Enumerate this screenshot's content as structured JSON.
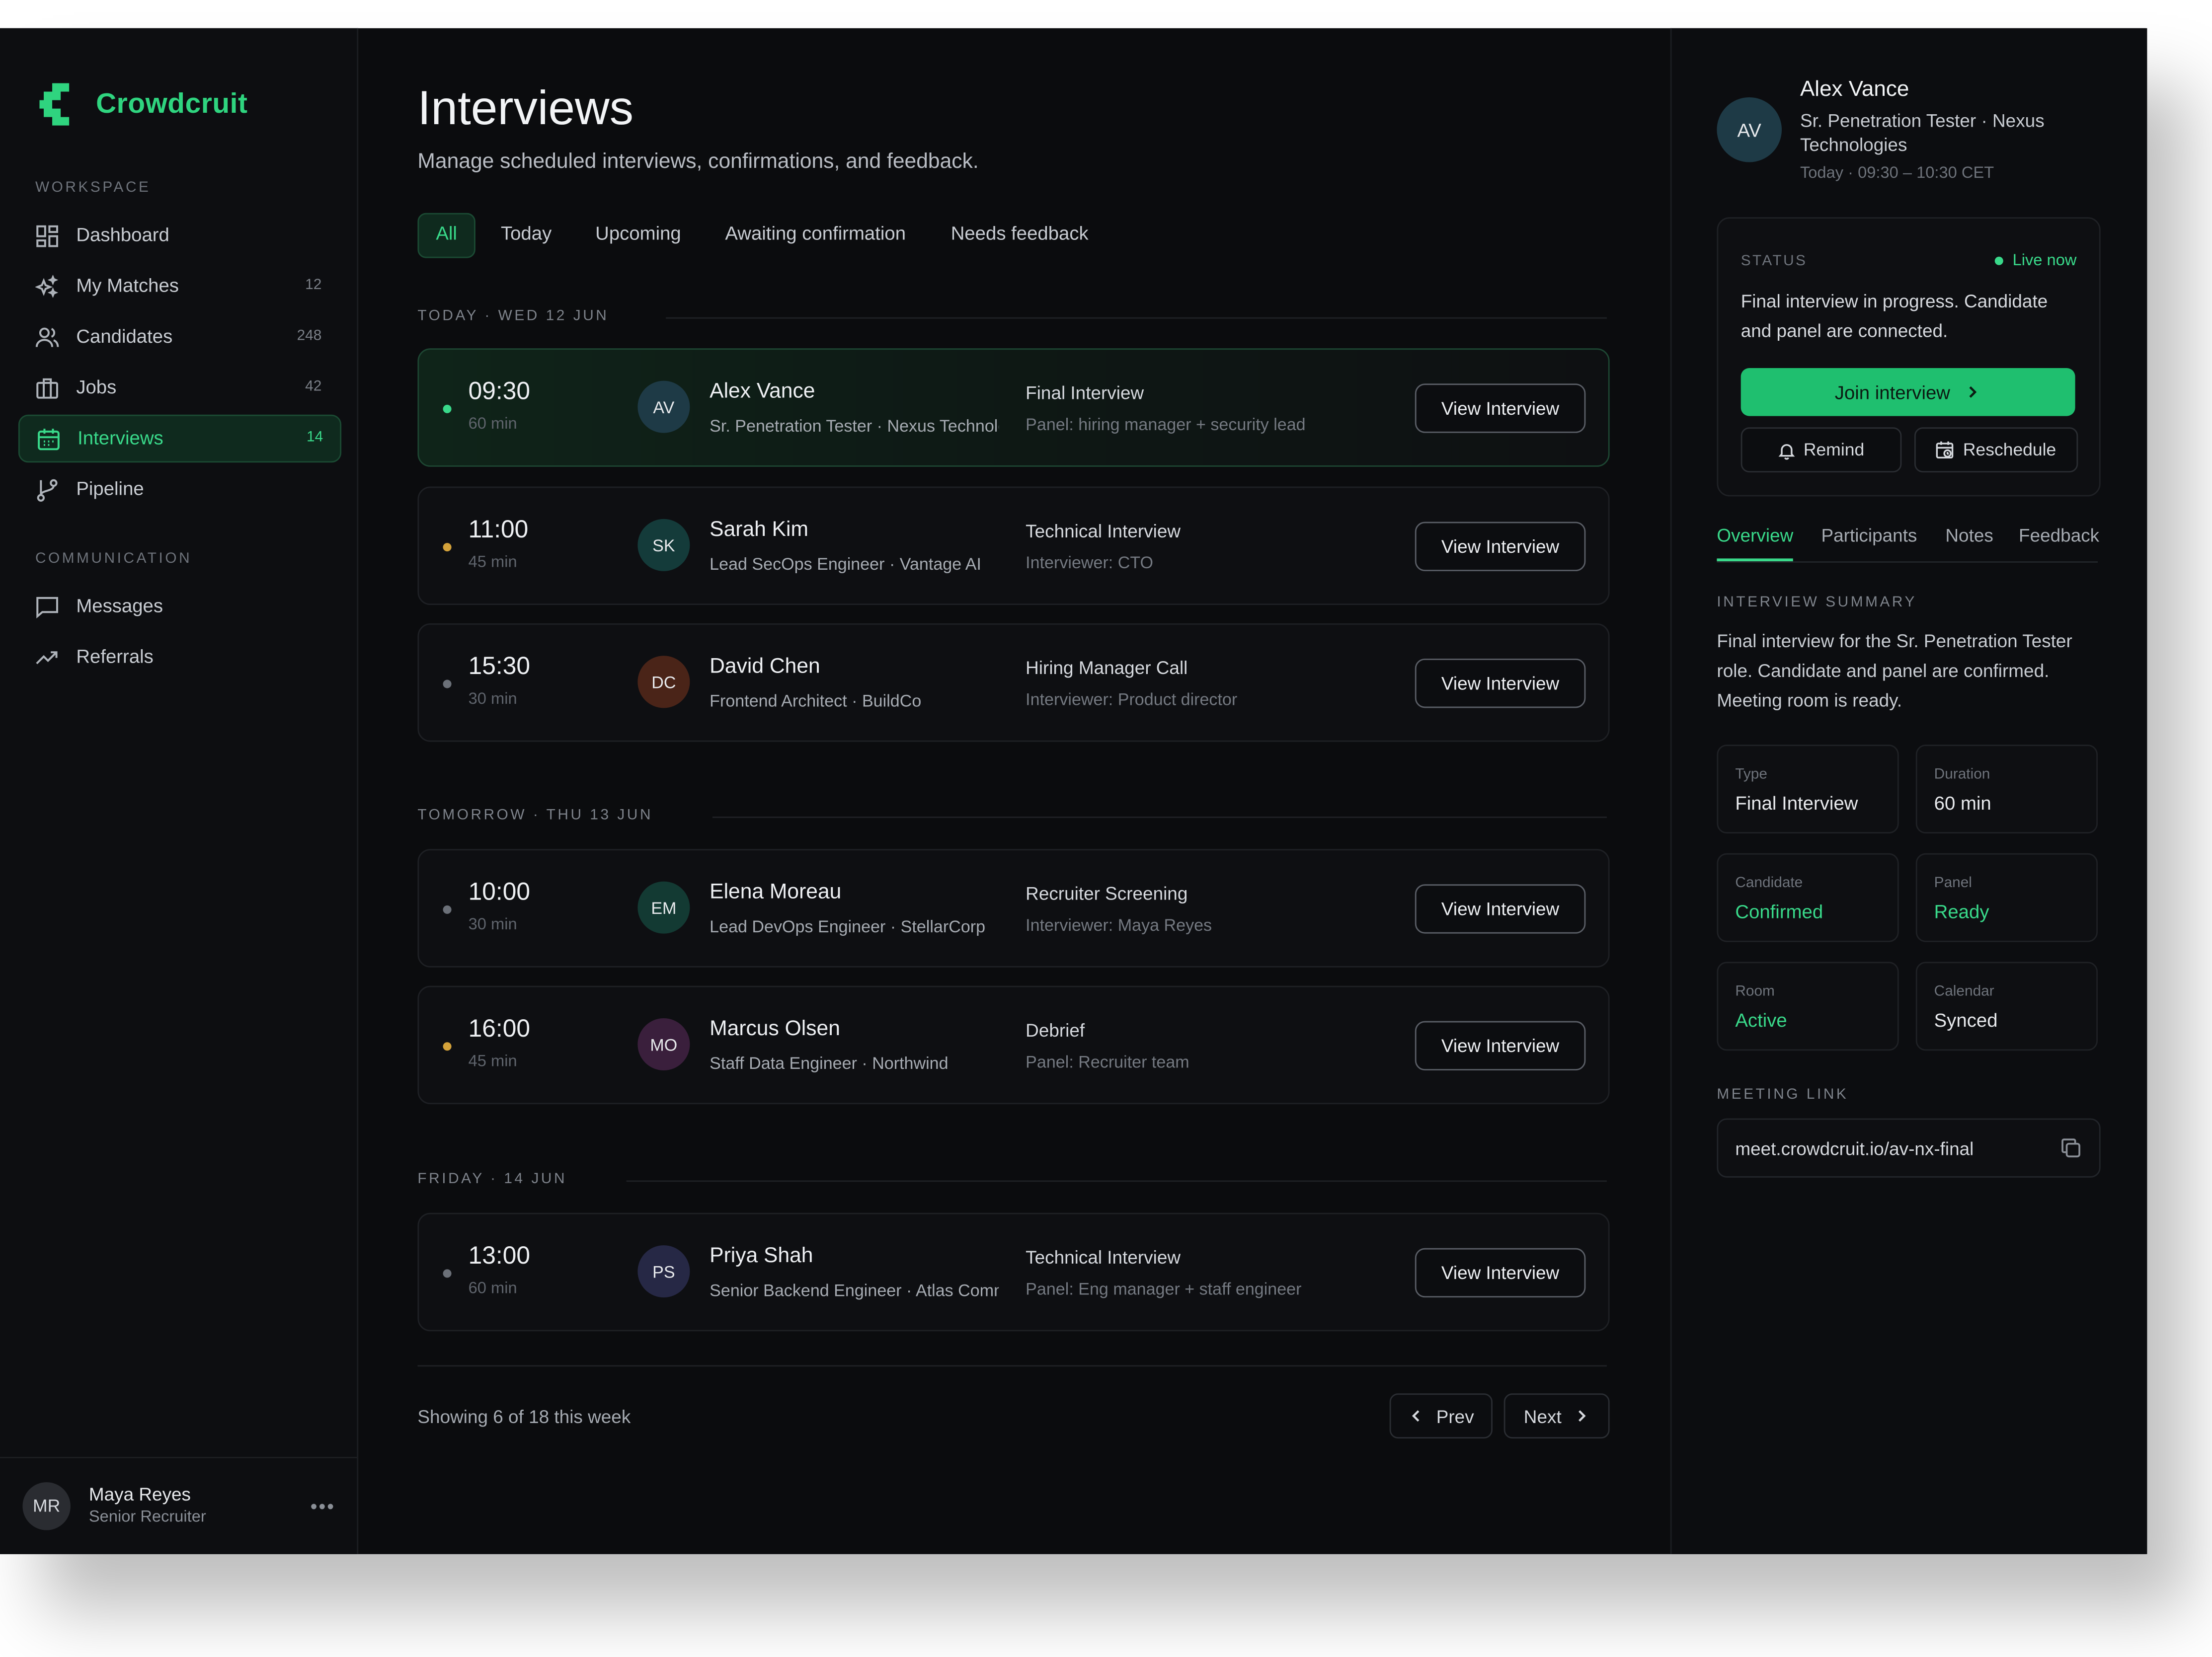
{
  "brand": {
    "name": "Crowdcruit",
    "accent": "#2fd47f"
  },
  "sidebar": {
    "workspace_label": "WORKSPACE",
    "communication_label": "COMMUNICATION",
    "items": [
      {
        "label": "Dashboard",
        "count": "",
        "icon": "dashboard-icon"
      },
      {
        "label": "My Matches",
        "count": "12",
        "icon": "sparkles-icon"
      },
      {
        "label": "Candidates",
        "count": "248",
        "icon": "users-icon"
      },
      {
        "label": "Jobs",
        "count": "42",
        "icon": "briefcase-icon"
      },
      {
        "label": "Interviews",
        "count": "14",
        "icon": "calendar-icon"
      },
      {
        "label": "Pipeline",
        "count": "",
        "icon": "git-branch-icon"
      }
    ],
    "comm_items": [
      {
        "label": "Messages",
        "icon": "message-icon"
      },
      {
        "label": "Referrals",
        "icon": "trending-up-icon"
      }
    ],
    "user": {
      "initials": "MR",
      "name": "Maya Reyes",
      "role": "Senior Recruiter",
      "more": "•••"
    }
  },
  "main": {
    "title": "Interviews",
    "subtitle": "Manage scheduled interviews, confirmations, and feedback.",
    "tabs": [
      "All",
      "Today",
      "Upcoming",
      "Awaiting confirmation",
      "Needs feedback"
    ],
    "groups": [
      {
        "header": "TODAY · WED 12 JUN",
        "interviews": [
          {
            "time": "09:30",
            "duration": "60 min",
            "initials": "AV",
            "name": "Alex Vance",
            "role": "Sr. Penetration Tester · Nexus Technologies",
            "type": "Final Interview",
            "panel": "Panel: hiring manager + security lead",
            "button": "View Interview",
            "dot": "#39d98a"
          },
          {
            "time": "11:00",
            "duration": "45 min",
            "initials": "SK",
            "name": "Sarah Kim",
            "role": "Lead SecOps Engineer · Vantage AI",
            "type": "Technical Interview",
            "panel": "Interviewer: CTO",
            "button": "View Interview",
            "dot": "#d4a23a"
          },
          {
            "time": "15:30",
            "duration": "30 min",
            "initials": "DC",
            "name": "David Chen",
            "role": "Frontend Architect · BuildCo",
            "type": "Hiring Manager Call",
            "panel": "Interviewer: Product director",
            "button": "View Interview",
            "dot": "#6b7078"
          }
        ]
      },
      {
        "header": "TOMORROW · THU 13 JUN",
        "interviews": [
          {
            "time": "10:00",
            "duration": "30 min",
            "initials": "EM",
            "name": "Elena Moreau",
            "role": "Lead DevOps Engineer · StellarCorp",
            "type": "Recruiter Screening",
            "panel": "Interviewer: Maya Reyes",
            "button": "View Interview",
            "dot": "#6b7078"
          },
          {
            "time": "16:00",
            "duration": "45 min",
            "initials": "MO",
            "name": "Marcus Olsen",
            "role": "Staff Data Engineer · Northwind",
            "type": "Debrief",
            "panel": "Panel: Recruiter team",
            "button": "View Interview",
            "dot": "#d4a23a"
          }
        ]
      },
      {
        "header": "FRIDAY · 14 JUN",
        "interviews": [
          {
            "time": "13:00",
            "duration": "60 min",
            "initials": "PS",
            "name": "Priya Shah",
            "role": "Senior Backend Engineer · Atlas Commerce",
            "type": "Technical Interview",
            "panel": "Panel: Eng manager + staff engineer",
            "button": "View Interview",
            "dot": "#6b7078"
          }
        ]
      }
    ],
    "showing": "Showing 6 of 18 this week",
    "prev": "Prev",
    "next": "Next"
  },
  "detail": {
    "initials": "AV",
    "name": "Alex Vance",
    "role": "Sr. Penetration Tester · Nexus Technologies",
    "time": "Today · 09:30 – 10:30 CET",
    "status_label": "STATUS",
    "live": "Live now",
    "status_text": "Final interview in progress. Candidate and panel are connected.",
    "join": "Join interview",
    "remind": "Remind",
    "reschedule": "Reschedule",
    "tabs": [
      "Overview",
      "Participants",
      "Notes",
      "Feedback"
    ],
    "summary_label": "INTERVIEW SUMMARY",
    "summary": "Final interview for the Sr. Penetration Tester role. Candidate and panel are confirmed. Meeting room is ready.",
    "tiles": [
      {
        "label": "Type",
        "value": "Final Interview",
        "green": false
      },
      {
        "label": "Duration",
        "value": "60 min",
        "green": false
      },
      {
        "label": "Candidate",
        "value": "Confirmed",
        "green": true
      },
      {
        "label": "Panel",
        "value": "Ready",
        "green": true
      },
      {
        "label": "Room",
        "value": "Active",
        "green": true
      },
      {
        "label": "Calendar",
        "value": "Synced",
        "green": false
      }
    ],
    "link_label": "MEETING LINK",
    "link": "meet.crowdcruit.io/av-nx-final"
  }
}
